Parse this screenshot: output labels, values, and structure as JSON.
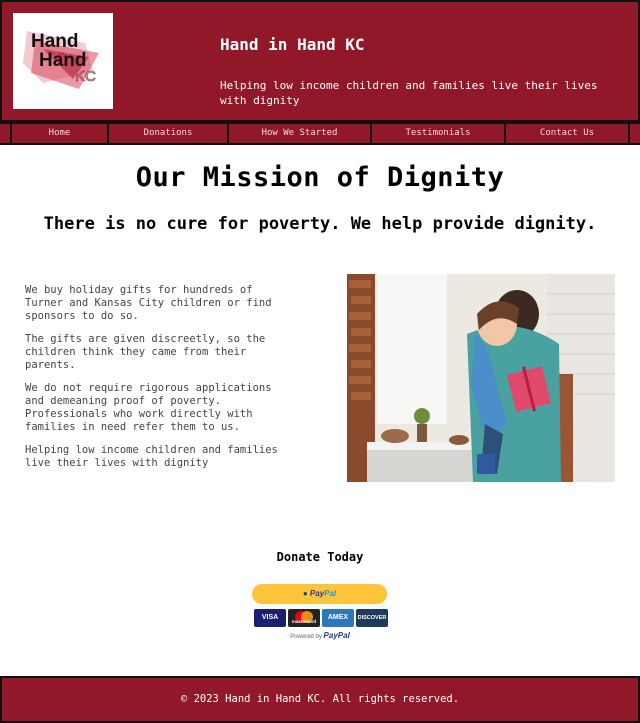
{
  "colors": {
    "brand": "#901828",
    "paypal_yellow": "#ffc439"
  },
  "header": {
    "logo_text": [
      "Hand",
      "in",
      "Hand",
      "KC"
    ],
    "title": "Hand in Hand KC",
    "tagline": "Helping low income children and families live their lives with dignity"
  },
  "nav": {
    "items": [
      {
        "label": "Home"
      },
      {
        "label": "Donations"
      },
      {
        "label": "How We Started"
      },
      {
        "label": "Testimonials"
      },
      {
        "label": "Contact Us"
      }
    ]
  },
  "main": {
    "headline": "Our Mission of Dignity",
    "subheadline": "There is no cure for poverty. We help provide dignity.",
    "paragraphs": [
      "We buy holiday gifts for hundreds of Turner and Kansas City children or find sponsors to do so.",
      "The gifts are given discreetly, so the children think they came from their parents.",
      "We do not require rigorous applications and demeaning proof of poverty. Professionals who work directly with families in need refer them to us.",
      "Helping low income children and families live their lives with dignity"
    ],
    "photo_icon": "family-gift-photo"
  },
  "donate": {
    "title": "Donate Today",
    "button_label_pay": "Pay",
    "button_label_pal": "Pal",
    "cards": [
      "VISA",
      "mastercard",
      "AMEX",
      "DISCOVER"
    ],
    "powered_prefix": "Powered by",
    "powered_brand": "PayPal"
  },
  "footer": {
    "copyright": "© 2023 Hand in Hand KC. All rights reserved."
  }
}
